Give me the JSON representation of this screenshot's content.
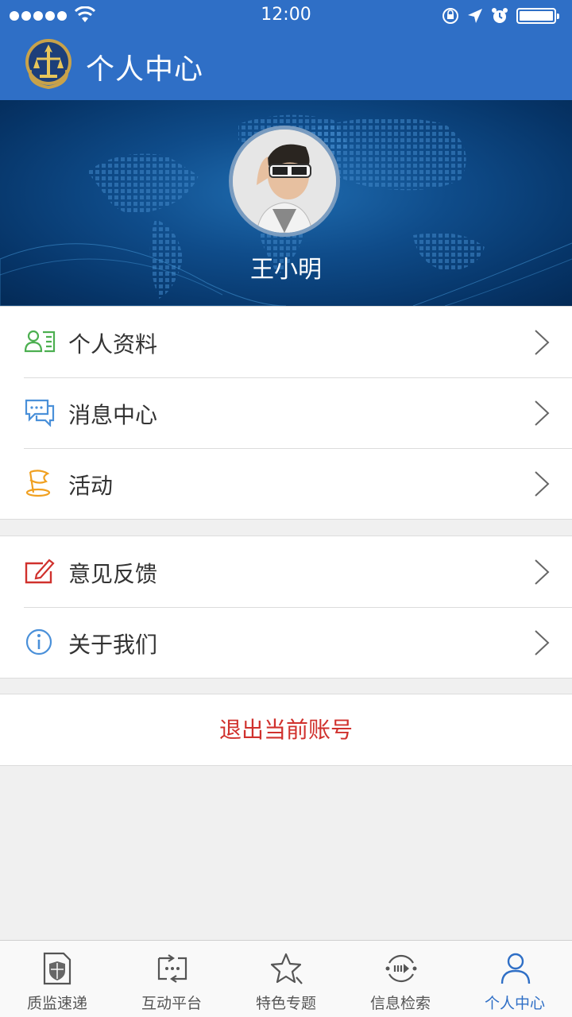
{
  "status_bar": {
    "time": "12:00",
    "signal_icon": "signal-dots-icon",
    "wifi_icon": "wifi-icon",
    "orientation_lock_icon": "orientation-lock-icon",
    "location_icon": "location-arrow-icon",
    "alarm_icon": "alarm-icon",
    "battery_icon": "battery-icon"
  },
  "header": {
    "title": "个人中心",
    "logo_icon": "emblem-logo"
  },
  "profile": {
    "name": "王小明",
    "avatar_icon": "avatar"
  },
  "menu_group_1": [
    {
      "label": "个人资料",
      "icon": "profile-card-icon",
      "color": "#4caf50"
    },
    {
      "label": "消息中心",
      "icon": "message-bubble-icon",
      "color": "#4a90d9"
    },
    {
      "label": "活动",
      "icon": "flag-icon",
      "color": "#f0a020"
    }
  ],
  "menu_group_2": [
    {
      "label": "意见反馈",
      "icon": "edit-feedback-icon",
      "color": "#d0312d"
    },
    {
      "label": "关于我们",
      "icon": "info-icon",
      "color": "#4a90d9"
    }
  ],
  "logout": {
    "label": "退出当前账号",
    "color": "#d0312d"
  },
  "tabs": [
    {
      "label": "质监速递",
      "icon": "shield-doc-icon"
    },
    {
      "label": "互动平台",
      "icon": "interaction-icon"
    },
    {
      "label": "特色专题",
      "icon": "star-icon"
    },
    {
      "label": "信息检索",
      "icon": "search-circle-icon"
    },
    {
      "label": "个人中心",
      "icon": "person-icon",
      "active": true
    }
  ],
  "colors": {
    "primary": "#2f6fc6",
    "active_tab": "#2f6fc6",
    "background": "#f0f0f0"
  }
}
